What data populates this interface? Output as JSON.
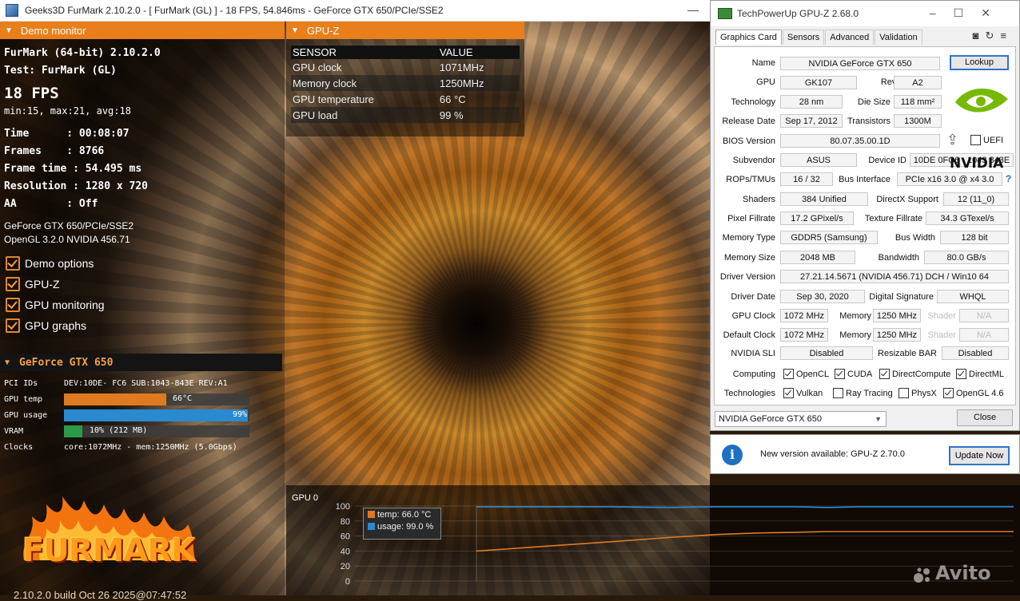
{
  "furmark": {
    "window_title": "Geeks3D FurMark 2.10.2.0 - [ FurMark (GL) ] - 18 FPS, 54.846ms - GeForce GTX 650/PCIe/SSE2",
    "demo_monitor": {
      "header": "Demo monitor",
      "app_line": "FurMark (64-bit) 2.10.2.0",
      "test_line": "Test: FurMark (GL)",
      "fps": "18 FPS",
      "fps_stats": "min:15, max:21, avg:18",
      "stats": [
        "Time      : 00:08:07",
        "Frames    : 8766",
        "Frame time : 54.495 ms",
        "Resolution : 1280 x 720",
        "AA        : Off"
      ],
      "renderer": "GeForce GTX 650/PCIe/SSE2",
      "opengl": "OpenGL 3.2.0 NVIDIA 456.71",
      "options": [
        "Demo options",
        "GPU-Z",
        "GPU monitoring",
        "GPU graphs"
      ]
    },
    "gpu_panel": {
      "header": "GeForce GTX 650",
      "pci_label": "PCI IDs",
      "pci_value": "DEV:10DE- FC6 SUB:1043-843E REV:A1",
      "temp_label": "GPU temp",
      "temp_value": "66°C",
      "temp_fraction": 0.55,
      "usage_label": "GPU usage",
      "usage_value": "99%",
      "usage_fraction": 0.99,
      "vram_label": "VRAM",
      "vram_value": "10% (212 MB)",
      "vram_fraction": 0.1,
      "clocks_label": "Clocks",
      "clocks_value": "core:1072MHz - mem:1250MHz (5.0Gbps)"
    },
    "logo_text": "FURMARK",
    "build": "2.10.2.0 build Oct 26 2025@07:47:52"
  },
  "gpuz_overlay": {
    "header": "GPU-Z",
    "col_sensor": "SENSOR",
    "col_value": "VALUE",
    "rows": [
      {
        "sensor": "GPU clock",
        "value": "1071MHz"
      },
      {
        "sensor": "Memory clock",
        "value": "1250MHz"
      },
      {
        "sensor": "GPU temperature",
        "value": "66 °C"
      },
      {
        "sensor": "GPU load",
        "value": "99 %"
      }
    ]
  },
  "graph": {
    "title": "GPU 0",
    "legend_temp": "temp: 66.0 °C",
    "legend_usage": "usage: 99.0 %",
    "temp_color": "#e07a20",
    "usage_color": "#2a8ad0"
  },
  "chart_data": {
    "type": "line",
    "title": "GPU 0",
    "ylim": [
      0,
      100
    ],
    "yticks": [
      0,
      20,
      40,
      60,
      80,
      100
    ],
    "series": [
      {
        "name": "temp: 66.0 °C",
        "values": [
          40,
          52,
          58,
          62,
          64,
          65,
          66,
          66,
          66,
          66,
          66,
          66,
          66,
          66
        ]
      },
      {
        "name": "usage: 99.0 %",
        "values": [
          99,
          99,
          98,
          99,
          99,
          99,
          98,
          99,
          99,
          99,
          99,
          99,
          99,
          99
        ]
      }
    ]
  },
  "gpuz": {
    "title": "TechPowerUp GPU-Z 2.68.0",
    "tabs": [
      "Graphics Card",
      "Sensors",
      "Advanced",
      "Validation"
    ],
    "lookup": "Lookup",
    "name_label": "Name",
    "name": "NVIDIA GeForce GTX 650",
    "gpu_label": "GPU",
    "gpu": "GK107",
    "revision_label": "Revision",
    "revision": "A2",
    "technology_label": "Technology",
    "technology": "28 nm",
    "die_size_label": "Die Size",
    "die_size": "118 mm²",
    "release_label": "Release Date",
    "release": "Sep 17, 2012",
    "transistors_label": "Transistors",
    "transistors": "1300M",
    "bios_label": "BIOS Version",
    "bios": "80.07.35.00.1D",
    "uefi": "UEFI",
    "subvendor_label": "Subvendor",
    "subvendor": "ASUS",
    "device_id_label": "Device ID",
    "device_id": "10DE 0FC6 - 1043 843E",
    "rops_label": "ROPs/TMUs",
    "rops": "16 / 32",
    "bus_label": "Bus Interface",
    "bus": "PCIe x16 3.0 @ x4 3.0",
    "shaders_label": "Shaders",
    "shaders": "384 Unified",
    "directx_label": "DirectX Support",
    "directx": "12 (11_0)",
    "pixel_label": "Pixel Fillrate",
    "pixel": "17.2 GPixel/s",
    "texture_label": "Texture Fillrate",
    "texture": "34.3 GTexel/s",
    "memtype_label": "Memory Type",
    "memtype": "GDDR5 (Samsung)",
    "buswidth_label": "Bus Width",
    "buswidth": "128 bit",
    "memsize_label": "Memory Size",
    "memsize": "2048 MB",
    "bandwidth_label": "Bandwidth",
    "bandwidth": "80.0 GB/s",
    "driver_ver_label": "Driver Version",
    "driver_ver": "27.21.14.5671 (NVIDIA 456.71) DCH / Win10 64",
    "driver_date_label": "Driver Date",
    "driver_date": "Sep 30, 2020",
    "digsig_label": "Digital Signature",
    "digsig": "WHQL",
    "gpu_clock_label": "GPU Clock",
    "gpu_clock": "1072 MHz",
    "memory_label": "Memory",
    "memory_clock": "1250 MHz",
    "shader_label": "Shader",
    "shader": "N/A",
    "default_clock_label": "Default Clock",
    "default_clock": "1072 MHz",
    "default_memory": "1250 MHz",
    "default_shader": "N/A",
    "sli_label": "NVIDIA SLI",
    "sli": "Disabled",
    "rebar_label": "Resizable BAR",
    "rebar": "Disabled",
    "computing_label": "Computing",
    "computing": [
      "OpenCL",
      "CUDA",
      "DirectCompute",
      "DirectML"
    ],
    "technologies_label": "Technologies",
    "technologies": [
      {
        "label": "Vulkan",
        "checked": true
      },
      {
        "label": "Ray Tracing",
        "checked": false
      },
      {
        "label": "PhysX",
        "checked": false
      },
      {
        "label": "OpenGL 4.6",
        "checked": true
      }
    ],
    "selected_card": "NVIDIA GeForce GTX 650",
    "close": "Close",
    "help": "?",
    "nvidia_text": "NVIDIA",
    "notice": "New version available: GPU-Z 2.70.0",
    "update": "Update Now"
  },
  "watermark": "Avito"
}
